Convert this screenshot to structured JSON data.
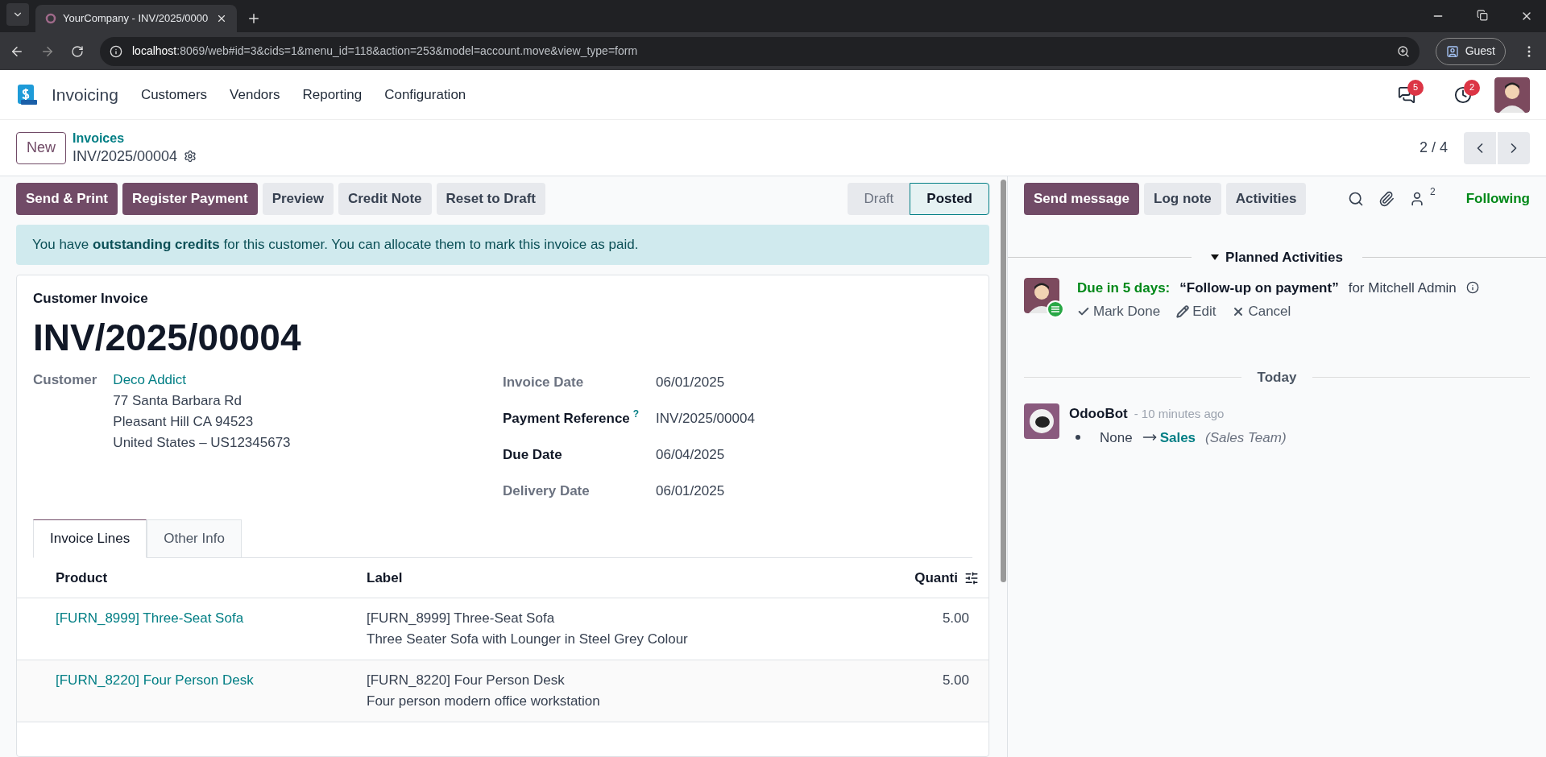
{
  "browser": {
    "tab_title": "YourCompany - INV/2025/0000",
    "url_host": "localhost",
    "url_rest": ":8069/web#id=3&cids=1&menu_id=118&action=253&model=account.move&view_type=form",
    "profile": "Guest"
  },
  "navbar": {
    "app": "Invoicing",
    "menu": [
      "Customers",
      "Vendors",
      "Reporting",
      "Configuration"
    ],
    "messages_badge": "5",
    "activities_badge": "2"
  },
  "control_panel": {
    "new_button": "New",
    "breadcrumb": "Invoices",
    "record": "INV/2025/00004",
    "pager": "2 / 4"
  },
  "actions": [
    {
      "label": "Send & Print",
      "kind": "primary"
    },
    {
      "label": "Register Payment",
      "kind": "primary"
    },
    {
      "label": "Preview",
      "kind": "secondary"
    },
    {
      "label": "Credit Note",
      "kind": "secondary"
    },
    {
      "label": "Reset to Draft",
      "kind": "secondary"
    }
  ],
  "stages": [
    {
      "label": "Draft",
      "selected": false
    },
    {
      "label": "Posted",
      "selected": true
    }
  ],
  "alert": "You have **outstanding credits** for this customer. You can allocate them to mark this invoice as paid.",
  "form": {
    "type_label": "Customer Invoice",
    "number": "INV/2025/00004",
    "customer_label": "Customer",
    "customer": "Deco Addict",
    "address": [
      "77 Santa Barbara Rd",
      "Pleasant Hill CA 94523",
      "United States – US12345673"
    ],
    "fields": [
      {
        "label": "Invoice Date",
        "value": "06/01/2025",
        "required": false,
        "help": false
      },
      {
        "label": "Payment Reference",
        "value": "INV/2025/00004",
        "required": true,
        "help": true
      },
      {
        "label": "Due Date",
        "value": "06/04/2025",
        "required": true,
        "help": false
      },
      {
        "label": "Delivery Date",
        "value": "06/01/2025",
        "required": false,
        "help": false
      }
    ],
    "help_mark": "?",
    "tabs": [
      {
        "label": "Invoice Lines",
        "selected": true
      },
      {
        "label": "Other Info",
        "selected": false
      }
    ],
    "table": {
      "columns": [
        "Product",
        "Label",
        "Quanti"
      ],
      "rows": [
        {
          "product": "[FURN_8999] Three-Seat Sofa",
          "label": [
            "[FURN_8999] Three-Seat Sofa",
            "Three Seater Sofa with Lounger in Steel Grey Colour"
          ],
          "quantity": "5.00"
        },
        {
          "product": "[FURN_8220] Four Person Desk",
          "label": [
            "[FURN_8220] Four Person Desk",
            "Four person modern office workstation"
          ],
          "quantity": "5.00"
        }
      ]
    }
  },
  "chatter": {
    "buttons": [
      {
        "label": "Send message",
        "kind": "primary"
      },
      {
        "label": "Log note",
        "kind": "secondary"
      },
      {
        "label": "Activities",
        "kind": "secondary"
      }
    ],
    "followers": "2",
    "following": "Following",
    "planned_title": "Planned Activities",
    "activity": {
      "due": "Due in 5 days:",
      "summary": "“Follow-up on payment”",
      "assignee": "for Mitchell Admin",
      "links": [
        "Mark Done",
        "Edit",
        "Cancel"
      ]
    },
    "day": "Today",
    "message": {
      "author": "OdooBot",
      "time": "- 10 minutes ago",
      "old": "None",
      "new": "Sales",
      "field": "(Sales Team)"
    }
  }
}
